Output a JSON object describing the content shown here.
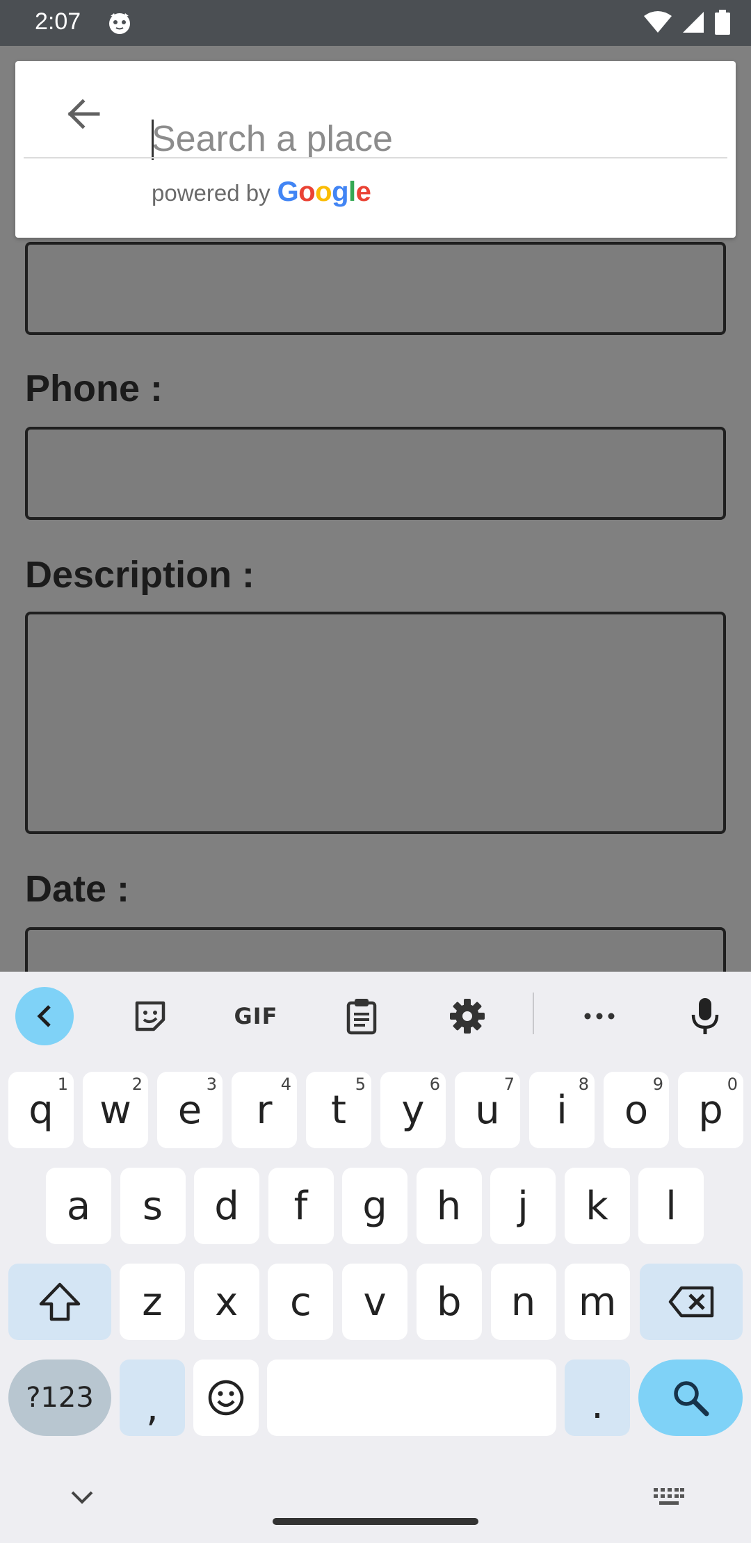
{
  "status_bar": {
    "time": "2:07"
  },
  "form": {
    "labels": [
      "Phone :",
      "Description :",
      "Date :"
    ]
  },
  "search": {
    "placeholder": "Search a place",
    "powered_prefix": "powered by",
    "google_letters": [
      "G",
      "o",
      "o",
      "g",
      "l",
      "e"
    ]
  },
  "keyboard": {
    "toolbar": {
      "gif_label": "GIF"
    },
    "row1": [
      {
        "k": "q",
        "s": "1"
      },
      {
        "k": "w",
        "s": "2"
      },
      {
        "k": "e",
        "s": "3"
      },
      {
        "k": "r",
        "s": "4"
      },
      {
        "k": "t",
        "s": "5"
      },
      {
        "k": "y",
        "s": "6"
      },
      {
        "k": "u",
        "s": "7"
      },
      {
        "k": "i",
        "s": "8"
      },
      {
        "k": "o",
        "s": "9"
      },
      {
        "k": "p",
        "s": "0"
      }
    ],
    "row2": [
      "a",
      "s",
      "d",
      "f",
      "g",
      "h",
      "j",
      "k",
      "l"
    ],
    "row3": [
      "z",
      "x",
      "c",
      "v",
      "b",
      "n",
      "m"
    ],
    "row4": {
      "numbers": "?123",
      "comma": ",",
      "period": "."
    }
  },
  "colors": {
    "accent": "#7fd2f7",
    "modifier_key": "#d4e5f4"
  }
}
